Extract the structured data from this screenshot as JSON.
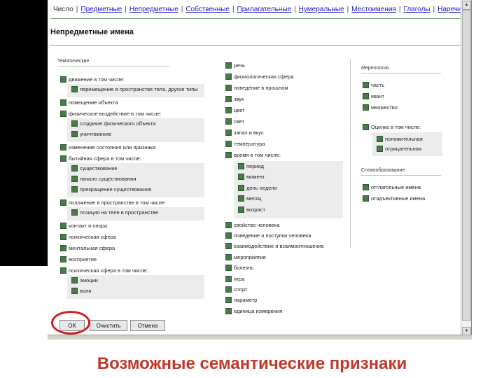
{
  "tabs": [
    "Число",
    "Предметные",
    "Непредметные",
    "Собственные",
    "Прилагательные",
    "Нумеральные",
    "Местоимения",
    "Глаголы",
    "Наречия"
  ],
  "active_tab": 0,
  "title": "Непредметные имена",
  "col1": {
    "group_label": "Тематические",
    "items": [
      {
        "label": "движение   в том числе:",
        "subs": [
          "перемещение в пространстве тела, другие типы"
        ]
      },
      {
        "label": "помещение объекта",
        "subs": []
      },
      {
        "label": "физическое воздействие   в том числе:",
        "subs": [
          "создание физического объекта",
          "уничтожение"
        ]
      },
      {
        "label": "изменение состояния или признака",
        "subs": []
      },
      {
        "label": "бытийная сфера   в том числе:",
        "subs": [
          "существование",
          "начало существования",
          "прекращение существования"
        ]
      },
      {
        "label": "положение в пространстве   в том числе:",
        "subs": [
          "позиция на теле в пространстве"
        ]
      },
      {
        "label": "контакт и опора",
        "subs": []
      },
      {
        "label": "психическая сфера",
        "subs": []
      },
      {
        "label": "ментальная сфера",
        "subs": []
      },
      {
        "label": "восприятие",
        "subs": []
      },
      {
        "label": "психическая сфера   в том числе:",
        "subs": [
          "эмоции",
          "воля"
        ]
      }
    ]
  },
  "col2": {
    "items_top": [
      "речь",
      "физиологическая сфера",
      "поведение в прошлом",
      "звук",
      "цвет",
      "свет",
      "запах и вкус",
      "температура",
      "время   в том числе:"
    ],
    "time_subs": [
      "период",
      "момент",
      "день недели",
      "месяц",
      "возраст"
    ],
    "items_bottom": [
      "свойство человека",
      "поведение и поступки человека",
      "взаимодействие и взаимоотношение",
      "мероприятие",
      "болезнь",
      "игра",
      "спорт",
      "параметр",
      "единица измерения"
    ]
  },
  "col3": {
    "group1_label": "Мереология",
    "group1_items": [
      "часть",
      "квант",
      "множество"
    ],
    "cases_label": "Оценка   в том числе:",
    "cases_subs": [
      "положительная",
      "отрицательная"
    ],
    "group2_label": "Словообразование",
    "group2_items": [
      "отглагольные имена",
      "отадъективные имена"
    ]
  },
  "buttons": {
    "ok": "OK",
    "clear": "Очистить",
    "cancel": "Отмена"
  },
  "caption": "Возможные семантические признаки"
}
